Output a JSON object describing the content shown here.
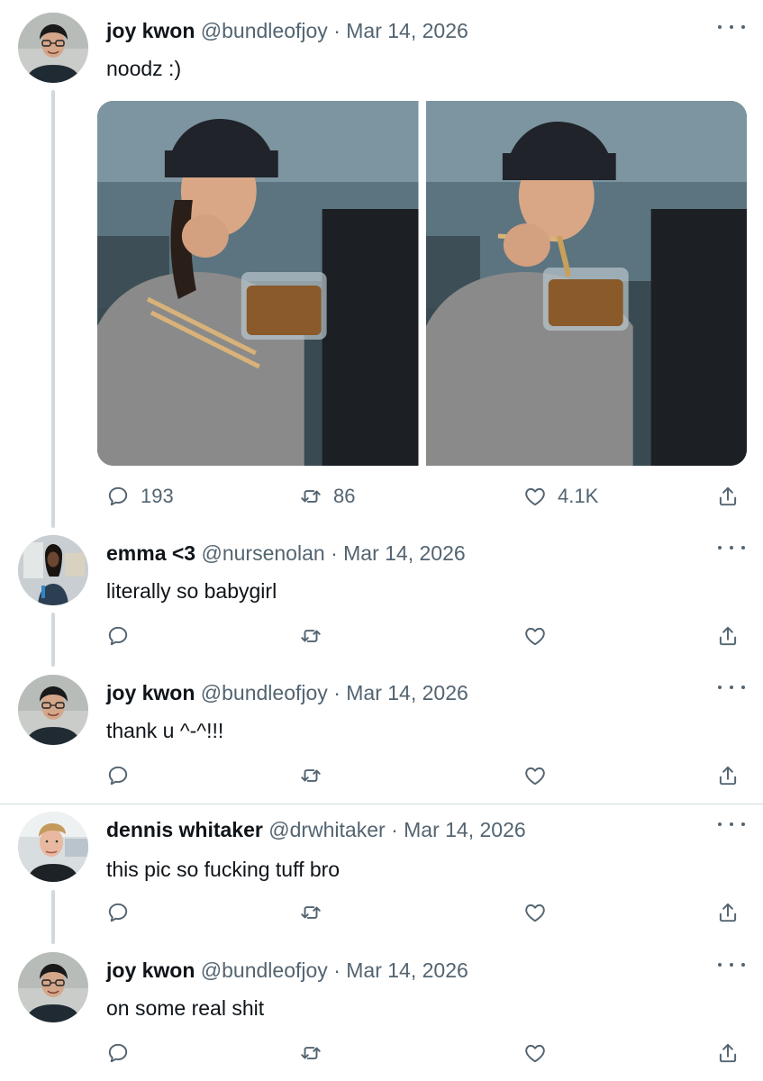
{
  "tweets": [
    {
      "name": "joy kwon",
      "handle": "@bundleofjoy",
      "separator": "·",
      "date": "Mar 14, 2026",
      "text": "noodz :)",
      "replies": "193",
      "retweets": "86",
      "likes": "4.1K",
      "avatar": "woman-glasses-avatar",
      "media": [
        "woman-beanie-eating-noodles-smiling",
        "woman-beanie-eating-noodles-biting"
      ]
    },
    {
      "name": "emma <3",
      "handle": "@nursenolan",
      "separator": "·",
      "date": "Mar 14, 2026",
      "text": "literally so babygirl",
      "replies": "",
      "retweets": "",
      "likes": "",
      "avatar": "nurse-scrubs-avatar"
    },
    {
      "name": "joy kwon",
      "handle": "@bundleofjoy",
      "separator": "·",
      "date": "Mar 14, 2026",
      "text": "thank u ^-^!!!",
      "replies": "",
      "retweets": "",
      "likes": "",
      "avatar": "woman-glasses-avatar"
    },
    {
      "name": "dennis whitaker",
      "handle": "@drwhitaker",
      "separator": "·",
      "date": "Mar 14, 2026",
      "text": "this pic so fucking tuff bro",
      "replies": "",
      "retweets": "",
      "likes": "",
      "avatar": "man-blond-avatar"
    },
    {
      "name": "joy kwon",
      "handle": "@bundleofjoy",
      "separator": "·",
      "date": "Mar 14, 2026",
      "text": "on some real shit",
      "replies": "",
      "retweets": "",
      "likes": "",
      "avatar": "woman-glasses-avatar"
    }
  ],
  "icons": {
    "reply": "reply-icon",
    "retweet": "retweet-icon",
    "like": "heart-icon",
    "share": "share-icon",
    "more": "more-icon"
  },
  "colors": {
    "text": "#0f1419",
    "secondary": "#536471",
    "thread_line": "#cfd9de"
  }
}
